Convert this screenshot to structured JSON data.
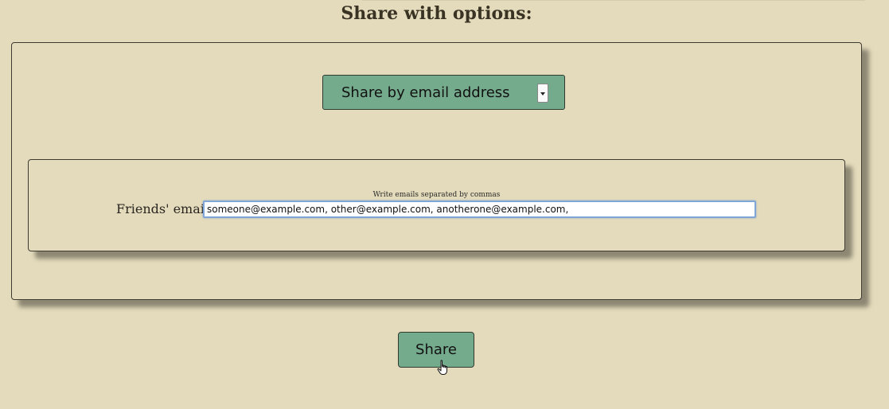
{
  "heading": "Share with options:",
  "share_method": {
    "selected": "Share by email address"
  },
  "email": {
    "hint": "Write emails separated by commas",
    "label": "Friends' email:",
    "value": "someone@example.com, other@example.com, anotherone@example.com,"
  },
  "share_button_label": "Share",
  "colors": {
    "background": "#e4dbbc",
    "button": "#75ab8d",
    "input_focus": "#7fa6d6"
  },
  "icons": {
    "cursor": "hand-pointer-icon",
    "dropdown": "dropdown-arrow-icon"
  }
}
